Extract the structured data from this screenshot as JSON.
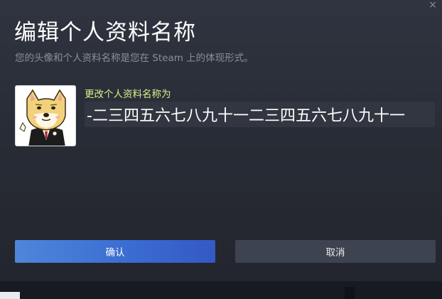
{
  "dialog": {
    "title": "编辑个人资料名称",
    "subtitle": "您的头像和个人资料名称是您在 Steam 上的体现形式。",
    "close_glyph": "×"
  },
  "form": {
    "label": "更改个人资料名称为",
    "name_value": "-二三四五六七八九十一二三四五六七八九十一"
  },
  "buttons": {
    "confirm_label": "确认",
    "cancel_label": "取消"
  },
  "colors": {
    "accent_label": "#d9f08a",
    "confirm_blue": "#3a6bd1",
    "cancel_gray": "#3d4350"
  }
}
